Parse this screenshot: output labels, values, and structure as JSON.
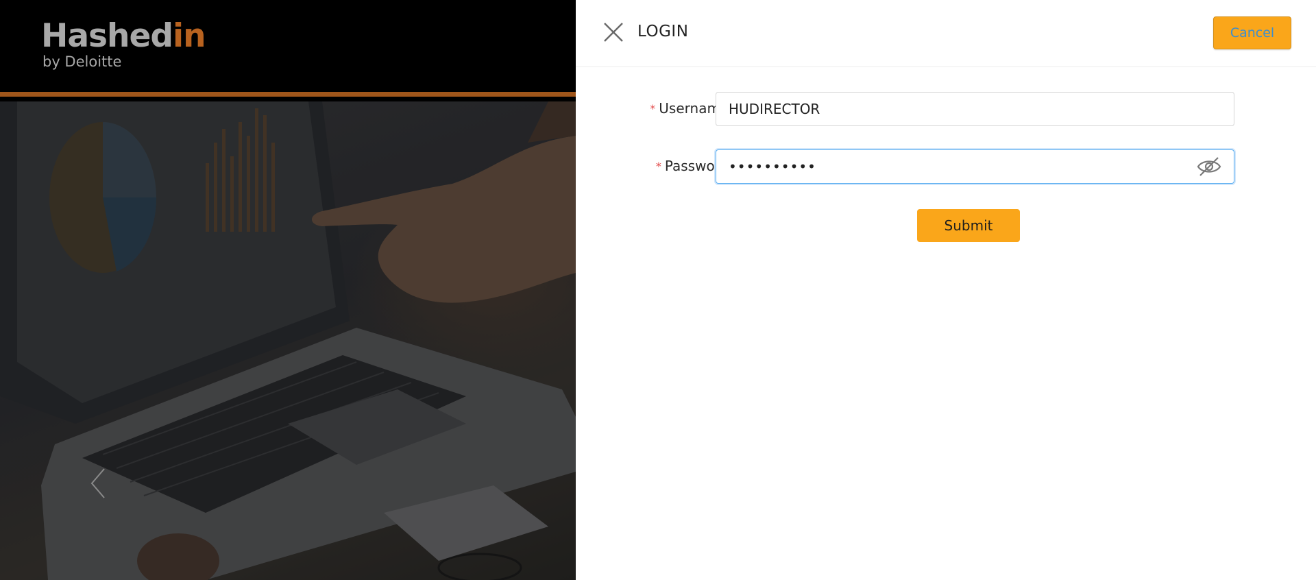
{
  "brand": {
    "logo_text_main": "Hashed",
    "logo_text_accent": "in",
    "logo_subtitle": "by Deloitte",
    "accent_color": "#b8621f",
    "divider_color": "#a0561b"
  },
  "carousel": {
    "prev_icon": "chevron-left-icon"
  },
  "login": {
    "title": "LOGIN",
    "close_icon": "close-icon",
    "cancel_label": "Cancel",
    "username": {
      "label": "Username",
      "value": "HUDIRECTOR",
      "required_mark": "*"
    },
    "password": {
      "label": "Password",
      "value": "••••••••••",
      "required_mark": "*",
      "toggle_icon": "eye-slash-icon"
    },
    "submit_label": "Submit",
    "button_color": "#faa61a"
  }
}
